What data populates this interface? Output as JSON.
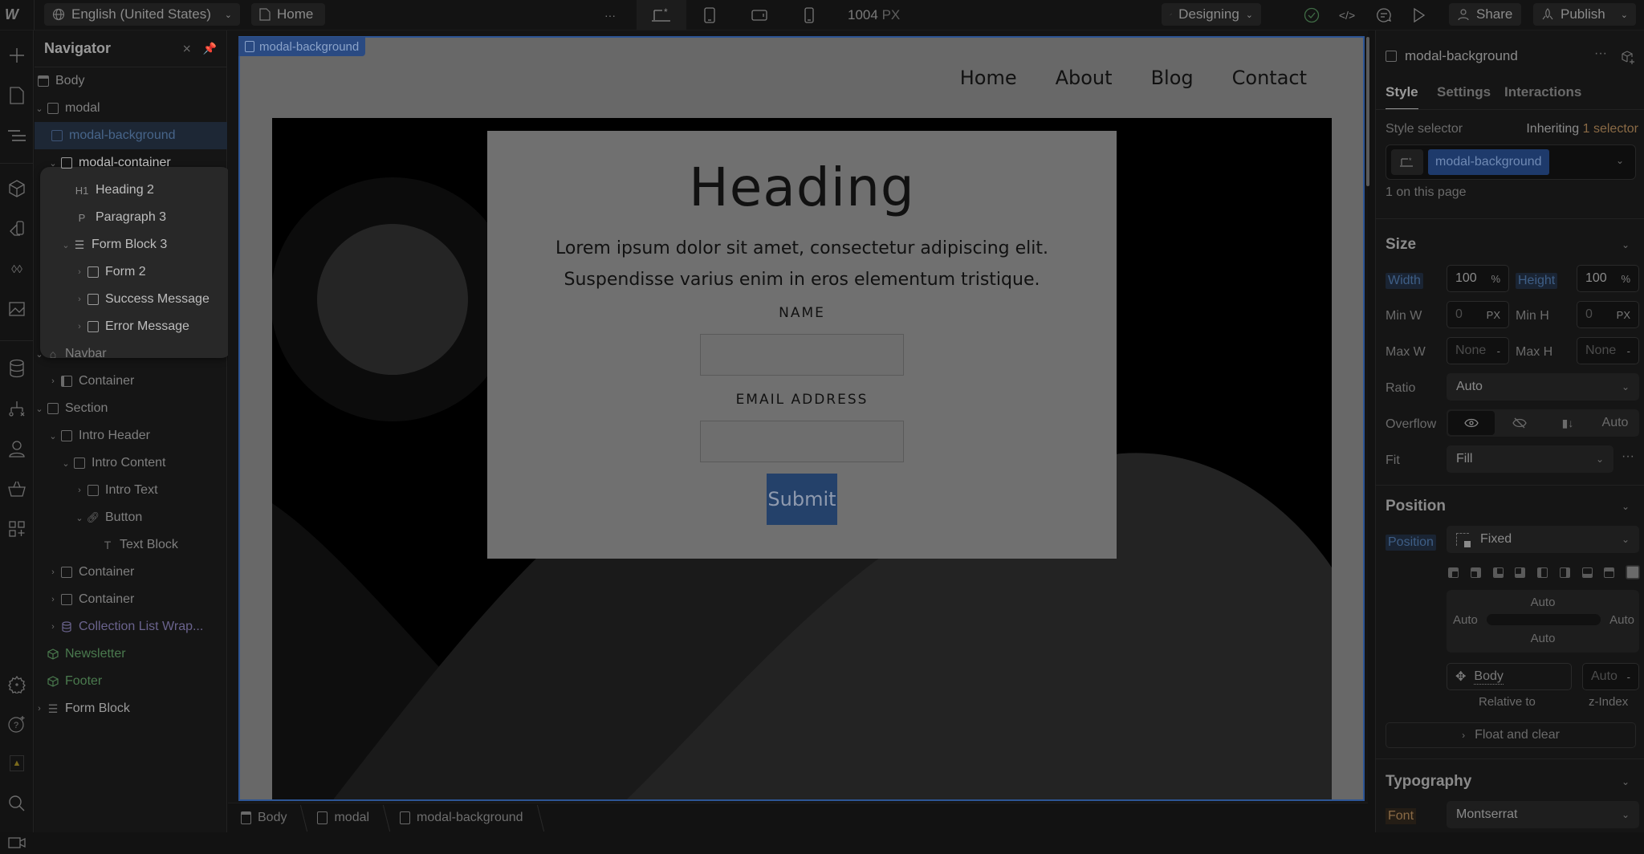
{
  "topbar": {
    "locale": "English (United States)",
    "page": "Home",
    "more": "···",
    "width_value": "1004",
    "width_unit": "PX",
    "mode": "Designing",
    "share": "Share",
    "publish": "Publish"
  },
  "navigator": {
    "title": "Navigator",
    "items": [
      {
        "label": "Body",
        "icon": "body-icon",
        "caret": ""
      },
      {
        "label": "modal",
        "icon": "div-box-icon",
        "caret": "⌄"
      },
      {
        "label": "modal-background",
        "icon": "div-box-icon",
        "caret": ""
      },
      {
        "label": "modal-container",
        "icon": "div-box-icon",
        "caret": "⌄"
      },
      {
        "label": "Heading 2",
        "icon": "H1",
        "caret": ""
      },
      {
        "label": "Paragraph 3",
        "icon": "P",
        "caret": ""
      },
      {
        "label": "Form Block 3",
        "icon": "form-block-icon",
        "caret": "⌄"
      },
      {
        "label": "Form 2",
        "icon": "div-box-icon",
        "caret": "›"
      },
      {
        "label": "Success Message",
        "icon": "div-box-icon",
        "caret": "›"
      },
      {
        "label": "Error Message",
        "icon": "div-box-icon",
        "caret": "›"
      },
      {
        "label": "Navbar",
        "icon": "home-icon",
        "caret": "⌄"
      },
      {
        "label": "Container",
        "icon": "container-icon",
        "caret": "›"
      },
      {
        "label": "Section",
        "icon": "div-box-icon",
        "caret": "⌄"
      },
      {
        "label": "Intro Header",
        "icon": "div-box-icon",
        "caret": "⌄"
      },
      {
        "label": "Intro Content",
        "icon": "div-box-icon",
        "caret": "⌄"
      },
      {
        "label": "Intro Text",
        "icon": "div-box-icon",
        "caret": "›"
      },
      {
        "label": "Button",
        "icon": "link-icon",
        "caret": "⌄"
      },
      {
        "label": "Text Block",
        "icon": "T",
        "caret": ""
      },
      {
        "label": "Container",
        "icon": "div-box-icon",
        "caret": "›"
      },
      {
        "label": "Container",
        "icon": "div-box-icon",
        "caret": "›"
      },
      {
        "label": "Collection List Wrap...",
        "icon": "database-icon",
        "caret": "›"
      },
      {
        "label": "Newsletter",
        "icon": "component-icon",
        "caret": ""
      },
      {
        "label": "Footer",
        "icon": "component-icon",
        "caret": ""
      },
      {
        "label": "Form Block",
        "icon": "form-block-icon",
        "caret": "›"
      }
    ]
  },
  "canvas": {
    "selected_tag": "modal-background",
    "site_nav": [
      "Home",
      "About",
      "Blog",
      "Contact"
    ],
    "modal": {
      "heading": "Heading",
      "paragraph_line1": "Lorem ipsum dolor sit amet, consectetur adipiscing elit.",
      "paragraph_line2": "Suspendisse varius enim in eros elementum tristique.",
      "name_label": "NAME",
      "name_value": "",
      "email_label": "EMAIL ADDRESS",
      "email_value": "",
      "submit": "Submit"
    }
  },
  "breadcrumbs": [
    "Body",
    "modal",
    "modal-background"
  ],
  "right_panel": {
    "element_name": "modal-background",
    "tabs": [
      "Style",
      "Settings",
      "Interactions"
    ],
    "active_tab": "Style",
    "style_selector_label": "Style selector",
    "inheriting_prefix": "Inheriting",
    "inheriting_link": "1 selector",
    "selector_chip": "modal-background",
    "on_page": "1 on this page",
    "size": {
      "title": "Size",
      "width_label": "Width",
      "width": "100",
      "width_unit": "%",
      "height_label": "Height",
      "height": "100",
      "height_unit": "%",
      "minw_label": "Min W",
      "minw": "0",
      "minw_unit": "PX",
      "minh_label": "Min H",
      "minh": "0",
      "minh_unit": "PX",
      "maxw_label": "Max W",
      "maxw": "None",
      "maxw_unit": "-",
      "maxh_label": "Max H",
      "maxh": "None",
      "maxh_unit": "-",
      "ratio_label": "Ratio",
      "ratio": "Auto",
      "overflow_label": "Overflow",
      "overflow_auto": "Auto",
      "fit_label": "Fit",
      "fit": "Fill"
    },
    "position": {
      "title": "Position",
      "label": "Position",
      "value": "Fixed",
      "top": "Auto",
      "left": "Auto",
      "right": "Auto",
      "bottom": "Auto",
      "relative_value": "Body",
      "relative_label": "Relative to",
      "zindex_value": "Auto",
      "zindex_unit": "-",
      "zindex_label": "z-Index",
      "float_clear": "Float and clear"
    },
    "typography": {
      "title": "Typography",
      "font_label": "Font",
      "font": "Montserrat"
    }
  },
  "colors": {
    "accent_blue": "#2d5595",
    "selection_chip": "#1e3a6b",
    "inherit_orange": "#8a6a45",
    "component_green": "#4a7a4e",
    "collection_purple": "#6a638d"
  }
}
